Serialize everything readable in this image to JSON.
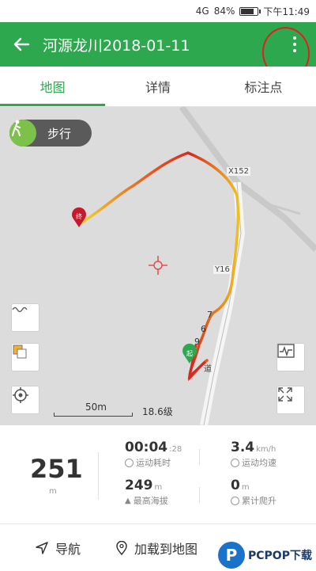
{
  "status": {
    "signal": "4G",
    "battery": "84%",
    "battery_level": 0.84,
    "time": "下午11:49"
  },
  "header": {
    "title": "河源龙川2018-01-11",
    "back_icon": "arrow-left-icon",
    "more_icon": "more-vertical-icon"
  },
  "tabs": [
    {
      "label": "地图",
      "active": true
    },
    {
      "label": "详情",
      "active": false
    },
    {
      "label": "标注点",
      "active": false
    }
  ],
  "map": {
    "mode": "步行",
    "road_labels": [
      "X152",
      "Y16",
      "道"
    ],
    "markers": {
      "end": "终",
      "start": "起"
    },
    "scale": "50m",
    "zoom": "18.6级",
    "km_marks": [
      "7",
      "6",
      "9"
    ]
  },
  "stats": {
    "distance": {
      "value": "251",
      "unit": "m"
    },
    "duration": {
      "value": "00:04",
      "sub": ":28",
      "label": "运动耗时"
    },
    "speed": {
      "value": "3.4",
      "unit": "km/h",
      "label": "运动均速"
    },
    "altitude": {
      "value": "249",
      "unit": "m",
      "label": "最高海拔"
    },
    "climb": {
      "value": "0",
      "unit": "m",
      "label": "累计爬升"
    }
  },
  "actions": {
    "navigate": "导航",
    "load_to_map": "加载到地图"
  },
  "watermark": {
    "logo": "P",
    "text": "PCPOP下载"
  },
  "colors": {
    "primary": "#2ea84f",
    "annotation": "#e0201c",
    "track_start": "#2ea84f",
    "track_end": "#d11a2a"
  }
}
